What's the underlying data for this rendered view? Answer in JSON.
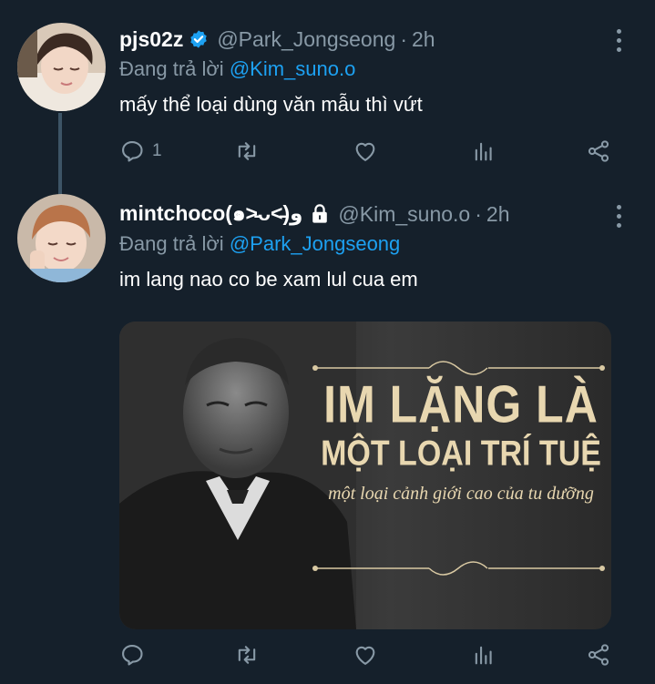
{
  "tweets": [
    {
      "name": "pjs02z",
      "verified": true,
      "handle": "@Park_Jongseong",
      "time": "2h",
      "reply_prefix": "Đang trả lời",
      "reply_to": "@Kim_suno.o",
      "text": "mấy thể loại dùng văn mẫu thì vứt",
      "reply_count": "1"
    },
    {
      "name": "mintchoco(๑˃̵ᴗ˂̵)و",
      "protected": true,
      "handle": "@Kim_suno.o",
      "time": "2h",
      "reply_prefix": "Đang trả lời",
      "reply_to": "@Park_Jongseong",
      "text": "im lang nao co be xam lul cua em",
      "media": {
        "line1": "IM LẶNG LÀ",
        "line2": "MỘT LOẠI TRÍ TUỆ",
        "line3": "một loại cảnh giới cao của tu dưỡng"
      }
    }
  ],
  "colors": {
    "background": "#15202b",
    "muted": "#8899a6",
    "link": "#1da1f2",
    "thread_line": "#3d5466",
    "quote_text": "#e8d7b0"
  },
  "separator": "·"
}
